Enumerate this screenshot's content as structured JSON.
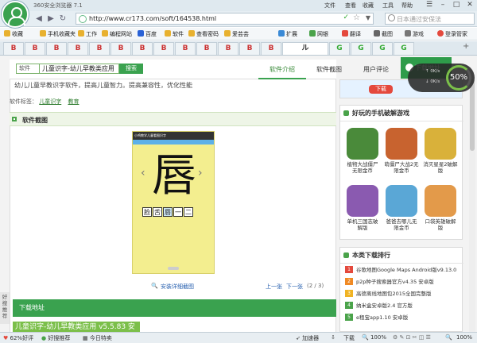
{
  "browser": {
    "app_title": "360安全浏览器 7.1",
    "menus": [
      "文件",
      "查看",
      "收藏",
      "工具",
      "帮助"
    ],
    "url": "http://www.cr173.com/soft/164538.html",
    "search_placeholder": "日本通过安保法"
  },
  "bookmarks": [
    "收藏",
    "手机收藏夹",
    "工作",
    "编程网站",
    "百度",
    "软件",
    "查看密码",
    "爱芸芸",
    "扩展",
    "网银",
    "翻译",
    "截图",
    "游戏",
    "登录管家"
  ],
  "tabs": [
    "B",
    "B",
    "B",
    "B",
    "B",
    "B",
    "B",
    "B",
    "B",
    "B",
    "B",
    "B",
    "B",
    "ル",
    "G",
    "G",
    "G",
    "G"
  ],
  "page": {
    "search": {
      "category": "软件",
      "query": "儿童识字-幼儿早教类应用",
      "button": "搜索"
    },
    "nav_tabs": [
      "软件介绍",
      "软件截图",
      "用户评论"
    ],
    "download_button": "下载地址",
    "intro": "幼儿儿童早教识字软件，提高儿童智力。提高兼容性，优化性能",
    "tags_label": "软件标签：",
    "tags": [
      "儿童识字",
      "教育"
    ],
    "screenshot_section": "软件截图",
    "phone": {
      "statusbar": "小鸡教学儿童看图识字",
      "big_char": "唇",
      "words": [
        "脸",
        "舌",
        "唇",
        "一",
        "二"
      ]
    },
    "image_link": "安装详细截图",
    "prev": "上一张",
    "next": "下一张",
    "counter": "(2 / 3)",
    "download_section": "下载地址",
    "filename": "儿童识字-幼儿早教类应用 v5.5.83 安"
  },
  "sidebar": {
    "ad_label": "下载",
    "games_title": "好玩的手机破解游戏",
    "games": [
      {
        "name": "植物大战僵尸无限金币",
        "color": "#4a8a3a"
      },
      {
        "name": "萌僵尸大战2无限金币",
        "color": "#c8632f"
      },
      {
        "name": "消灭星星2破解版",
        "color": "#d9b13a"
      },
      {
        "name": "单机三国志破解版",
        "color": "#8a5ab0"
      },
      {
        "name": "爸爸去哪儿无限金币",
        "color": "#5aa7d6"
      },
      {
        "name": "口袋英雄破解版",
        "color": "#e39a4a"
      }
    ],
    "ranking_title": "本类下载排行",
    "ranking": [
      {
        "rank": "1",
        "name": "谷歌地图Google Maps Android版v9.13.0"
      },
      {
        "rank": "2",
        "name": "p2p种子搜索器官方v4.35 安卓版"
      },
      {
        "rank": "3",
        "name": "高德离线地图包2015全国完整版"
      },
      {
        "rank": "4",
        "name": "纳米盒安卓版2.4 官方版"
      },
      {
        "rank": "5",
        "name": "e租宝app1.10 安卓版"
      }
    ],
    "rank_colors": [
      "#e4493d",
      "#f08a24",
      "#f0b324",
      "#4aa34a",
      "#4aa34a"
    ]
  },
  "speed_widget": {
    "percent": "50%",
    "up": "0K/s",
    "down": "0K/s"
  },
  "side_tab": "好搜推荐",
  "status": {
    "left": [
      "62%好评",
      "好搜推荐",
      "今日特卖"
    ],
    "accelerator": "加速器",
    "download": "下载",
    "zoom": "100%"
  }
}
